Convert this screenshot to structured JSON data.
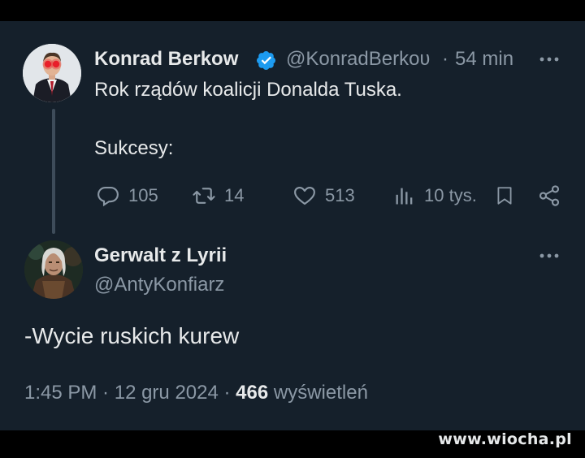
{
  "tweet1": {
    "author_name": "Konrad Berkow",
    "handle": "@KonradBerkoʋ",
    "separator": "·",
    "time": "54 min",
    "text_line1": "Rok rządów koalicji Donalda Tuska.",
    "text_line2": "Sukcesy:",
    "replies": "105",
    "retweets": "14",
    "likes": "513",
    "views": "10 tys."
  },
  "tweet2": {
    "author_name": "Gerwalt z Lyrii",
    "handle": "@AntyKonfiarz",
    "text": "-Wycie ruskich kurew",
    "time": "1:45 PM",
    "dot1": " · ",
    "date": "12 gru 2024",
    "dot2": " · ",
    "views_count": "466",
    "views_label": " wyświetleń"
  },
  "watermark": "www.wiocha.pl",
  "colors": {
    "background": "#15202b",
    "text": "#e7e9ea",
    "muted": "#8b98a5",
    "verified": "#1d9bf0"
  }
}
